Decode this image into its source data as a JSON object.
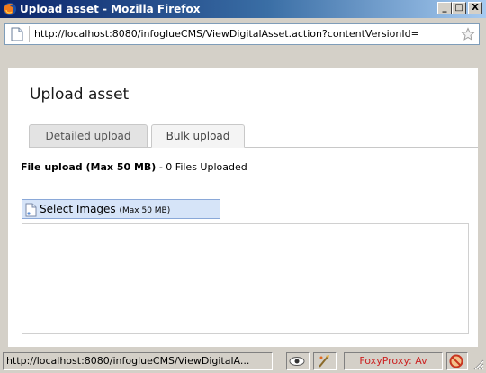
{
  "window": {
    "title": "Upload asset - Mozilla Firefox",
    "minimize_label": "_",
    "maximize_label": "□",
    "close_label": "X"
  },
  "address_bar": {
    "url": "http://localhost:8080/infoglueCMS/ViewDigitalAsset.action?contentVersionId="
  },
  "page": {
    "title": "Upload asset",
    "tabs": [
      {
        "label": "Detailed upload",
        "active": false
      },
      {
        "label": "Bulk upload",
        "active": true
      }
    ],
    "upload_status": {
      "label": "File upload (Max 50 MB)",
      "separator": " - ",
      "count_text": "0 Files Uploaded"
    },
    "select_button": {
      "label": "Select Images",
      "max_text": "(Max 50 MB)"
    }
  },
  "statusbar": {
    "url": "http://localhost:8080/infoglueCMS/ViewDigitalA...",
    "foxyproxy": "FoxyProxy: Av"
  },
  "icons": {
    "titlebar": "firefox-icon",
    "address_page": "page-icon",
    "bookmark": "star-icon",
    "select": "document-icon",
    "status_eye": "eye-icon",
    "status_addon": "addon-icon",
    "status_block": "block-icon"
  },
  "colors": {
    "titlebar_start": "#0a246a",
    "titlebar_end": "#a6caf0",
    "select_button_bg": "#d6e4f8",
    "foxyproxy_text": "#cc2222"
  }
}
